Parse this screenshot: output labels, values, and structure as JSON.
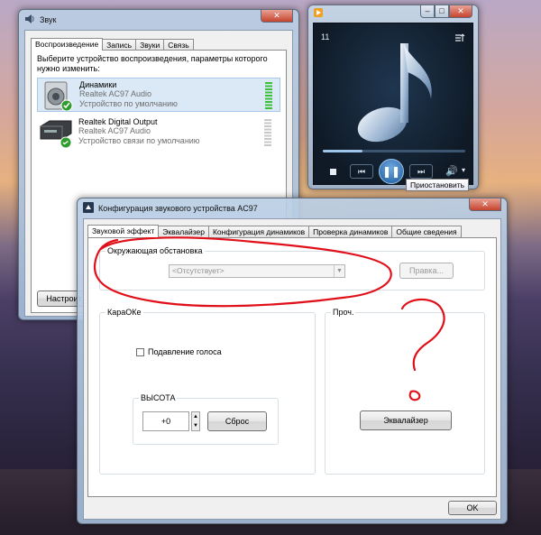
{
  "sound_window": {
    "title": "Звук",
    "tabs": [
      "Воспроизведение",
      "Запись",
      "Звуки",
      "Связь"
    ],
    "instruction": "Выберите устройство воспроизведения, параметры которого нужно изменить:",
    "devices": [
      {
        "name": "Динамики",
        "driver": "Realtek AC97 Audio",
        "status": "Устройство по умолчанию"
      },
      {
        "name": "Realtek Digital Output",
        "driver": "Realtek AC97 Audio",
        "status": "Устройство связи по умолчанию"
      }
    ],
    "configure_button": "Настроит"
  },
  "media_player": {
    "track_number": "11",
    "tooltip": "Приостановить",
    "progress": 0.28
  },
  "config_dialog": {
    "title": "Конфигурация звукового устройства AC97",
    "tabs": [
      "Звуковой эффект",
      "Эквалайзер",
      "Конфигурация динамиков",
      "Проверка динамиков",
      "Общие сведения"
    ],
    "environment_group": "Окружающая обстановка",
    "environment_select": "<Отсутствует>",
    "edit_button": "Правка...",
    "karaoke_group": "КараОКе",
    "voice_cancel_label": "Подавление голоса",
    "pitch_group": "ВЫСОТА",
    "pitch_value": "+0",
    "reset_button": "Сброс",
    "misc_group": "Проч.",
    "equalizer_button": "Эквалайзер",
    "ok_button": "OK"
  },
  "colors": {
    "annotation_red": "#e0101a",
    "player_bg": "#0f1a26",
    "level_green": "#3dbf3d"
  }
}
